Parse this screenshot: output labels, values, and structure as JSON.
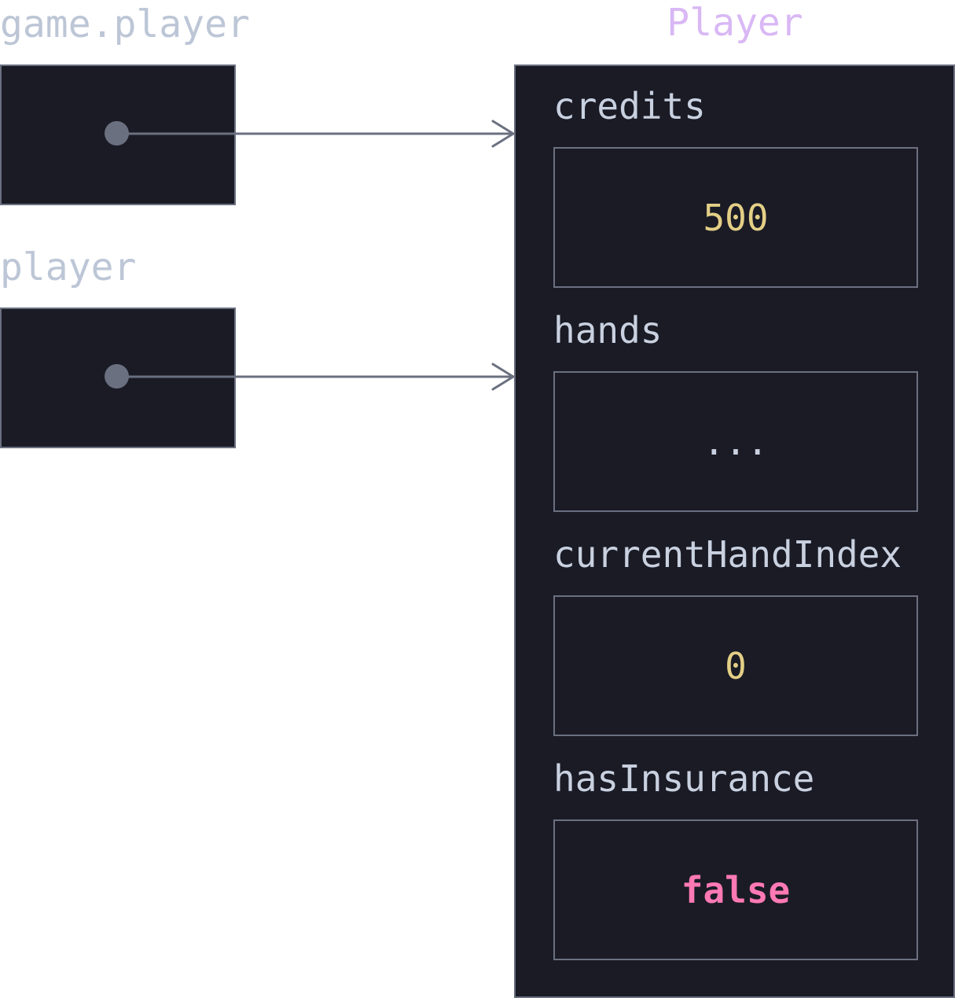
{
  "variables": [
    {
      "label": "game.player"
    },
    {
      "label": "player"
    }
  ],
  "object": {
    "type": "Player",
    "fields": [
      {
        "name": "credits",
        "value": "500"
      },
      {
        "name": "hands",
        "value": "..."
      },
      {
        "name": "currentHandIndex",
        "value": "0"
      },
      {
        "name": "hasInsurance",
        "value": "false"
      }
    ]
  },
  "colors": {
    "background": "#1a1b25",
    "border": "#6b7080",
    "label": "#bcc6d6",
    "type": "#d9b8f5",
    "number": "#e3cf86",
    "boolean": "#ff79b4"
  }
}
